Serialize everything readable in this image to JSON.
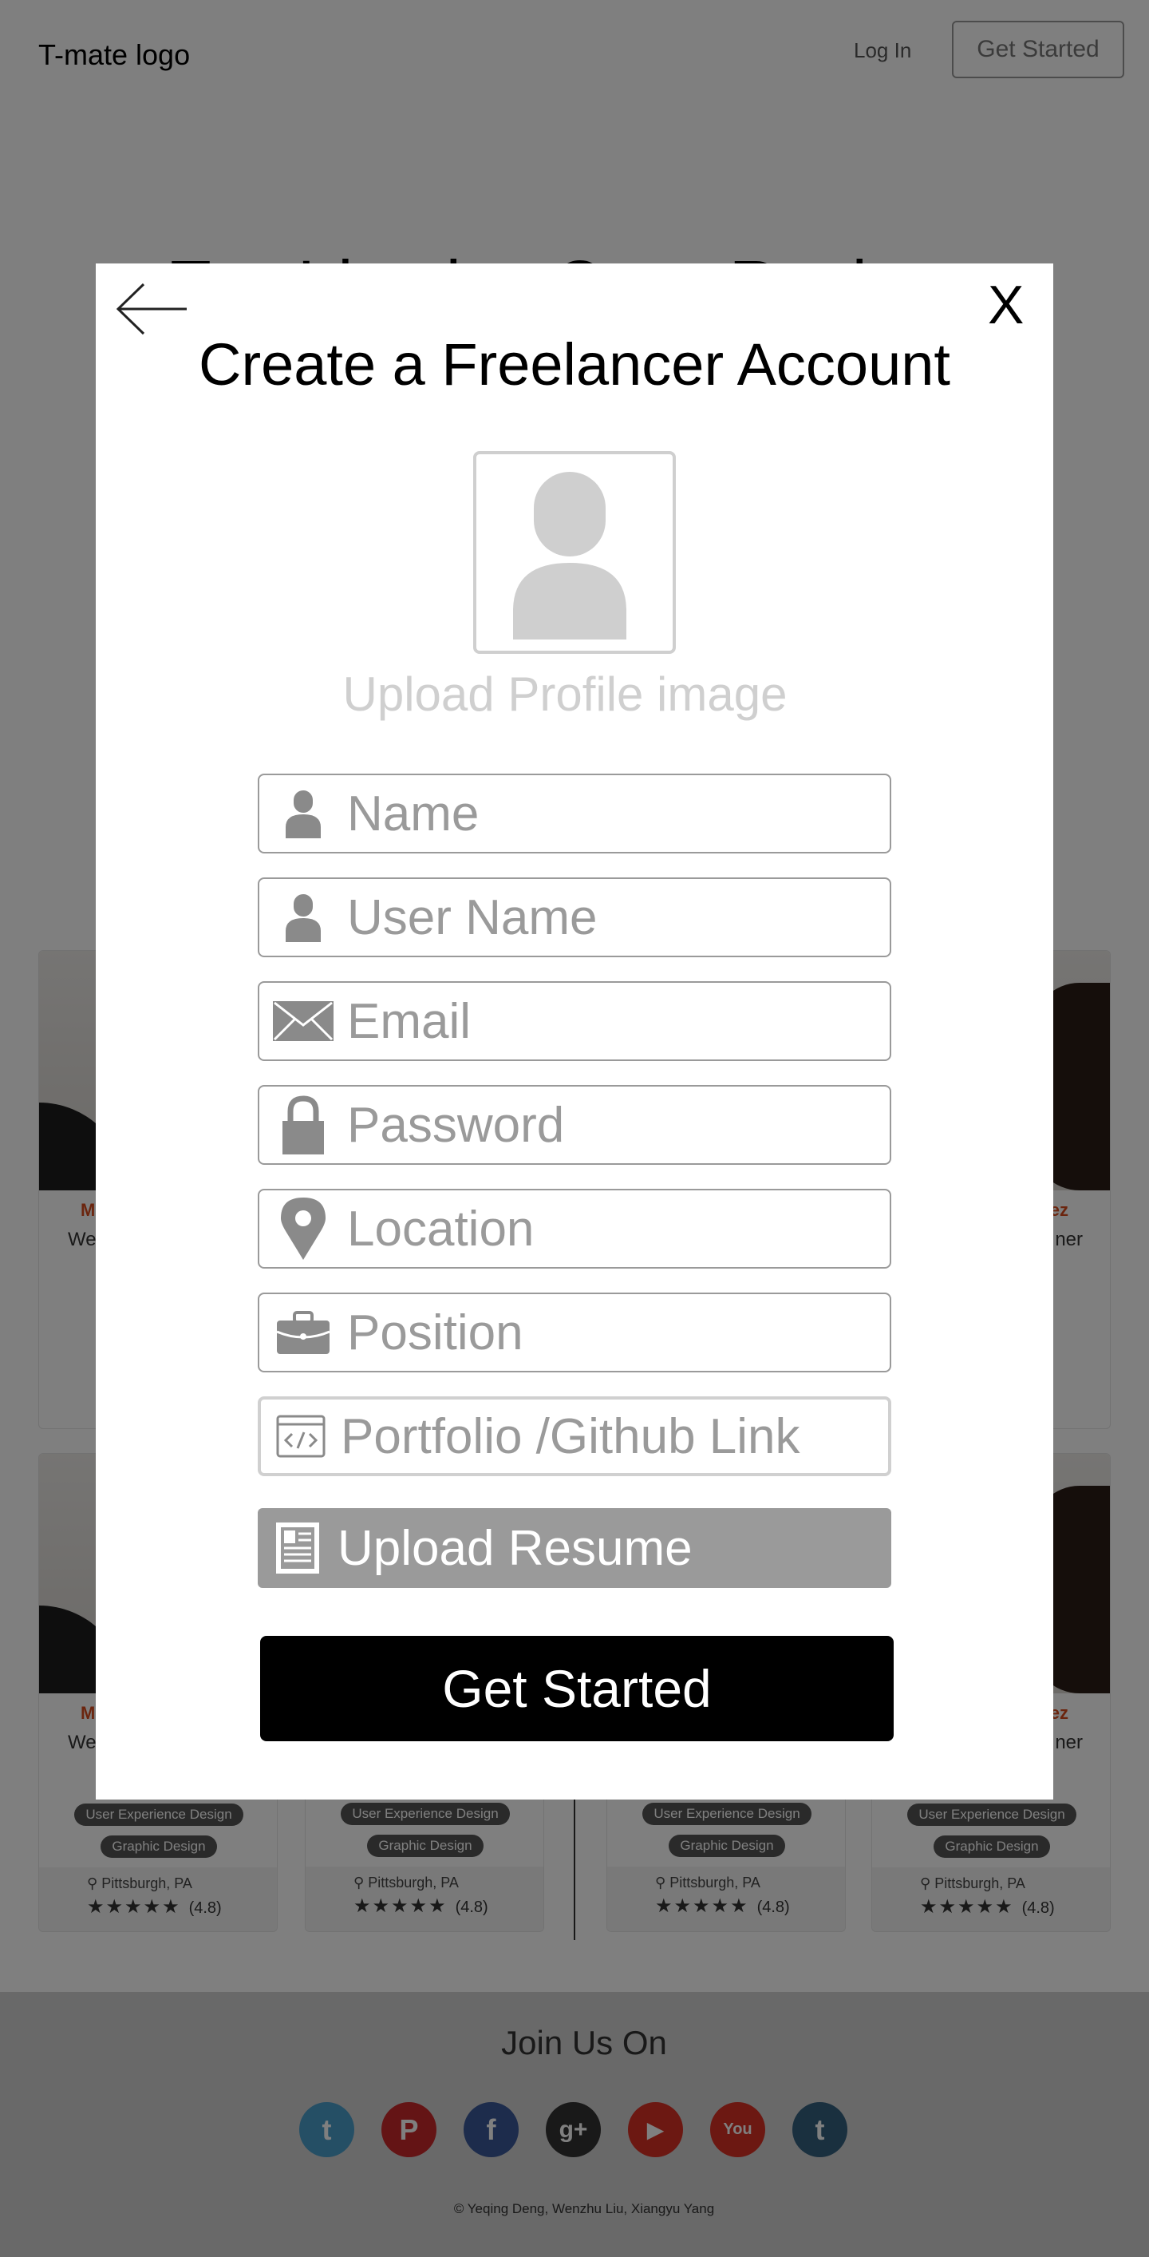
{
  "nav": {
    "logo": "T-mate logo",
    "login": "Log In",
    "get_started": "Get Started"
  },
  "hero": {
    "title": "Top Ideation Case Rankers"
  },
  "cards": [
    {
      "name_initial": "M",
      "role_prefix": "We",
      "tags": [
        "User Experience Design",
        "Graphic Design"
      ],
      "location": "Pittsburgh, PA",
      "stars": "★★★★★",
      "rating": "(4.8)"
    },
    {
      "name_initial": "",
      "role_prefix": "",
      "tags": [
        "User Experience Design",
        "Graphic Design"
      ],
      "location": "Pittsburgh, PA",
      "stars": "★★★★★",
      "rating": "(4.8)"
    },
    {
      "name_initial": "",
      "role_prefix": "",
      "tags": [
        "User Experience Design",
        "Graphic Design"
      ],
      "location": "Pittsburgh, PA",
      "stars": "★★★★★",
      "rating": "(4.8)"
    },
    {
      "name_initial": "ez",
      "role_prefix": "ner",
      "tags": [
        "User Experience Design",
        "Graphic Design"
      ],
      "location": "Pittsburgh, PA",
      "stars": "★★★★★",
      "rating": "(4.8)"
    }
  ],
  "footer": {
    "title": "Join Us On",
    "socials": [
      {
        "name": "twitter",
        "glyph": "t",
        "color": "#4a9ecb"
      },
      {
        "name": "pinterest",
        "glyph": "P",
        "color": "#c8282b"
      },
      {
        "name": "facebook",
        "glyph": "f",
        "color": "#3b5998"
      },
      {
        "name": "google-plus",
        "glyph": "g+",
        "color": "#333333"
      },
      {
        "name": "youtube",
        "glyph": "▶",
        "color": "#d93025"
      },
      {
        "name": "youtube-alt",
        "glyph": "You",
        "color": "#d93025"
      },
      {
        "name": "tumblr",
        "glyph": "t",
        "color": "#35607f"
      }
    ],
    "copyright": "© Yeqing Deng, Wenzhu Liu, Xiangyu Yang"
  },
  "modal": {
    "title": "Create a Freelancer Account",
    "close": "X",
    "upload_profile": "Upload Profile image",
    "fields": {
      "name": "Name",
      "username": "User Name",
      "email": "Email",
      "password": "Password",
      "location": "Location",
      "position": "Position",
      "portfolio": "Portfolio /Github Link"
    },
    "upload_resume": "Upload Resume",
    "submit": "Get Started"
  },
  "colors": {
    "accent": "#000000",
    "field_border": "#9a9a9a",
    "placeholder": "#9a9a9a",
    "overlay": "rgba(0,0,0,0.5)"
  }
}
